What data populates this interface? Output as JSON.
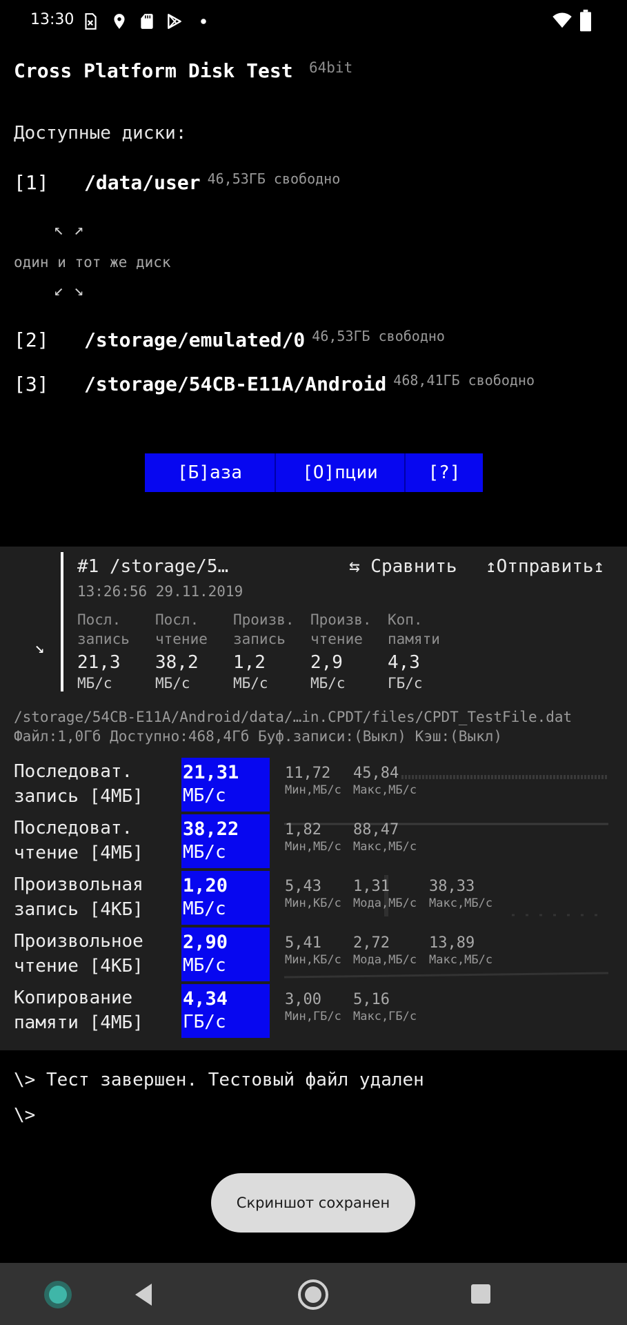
{
  "status_bar": {
    "time": "13:30",
    "icons_left": [
      "sim-card-off-icon",
      "location-icon",
      "sd-card-icon",
      "play-store-icon",
      "dot-icon"
    ],
    "icons_right": [
      "wifi-icon",
      "battery-icon"
    ]
  },
  "app": {
    "title": "Cross Platform Disk Test",
    "arch": "64bit"
  },
  "drives": {
    "heading": "Доступные диски:",
    "items": [
      {
        "num": "[1]",
        "path": "/data/user",
        "free": "46,53ГБ свободно"
      },
      {
        "num": "[2]",
        "path": "/storage/emulated/0",
        "free": "46,53ГБ свободно"
      },
      {
        "num": "[3]",
        "path": "/storage/54CB-E11A/Android",
        "free": "468,41ГБ свободно"
      }
    ],
    "same_disk_note": "один и тот же диск",
    "arrows_top": "↖ ↗",
    "arrows_bottom": "↙ ↘"
  },
  "buttons": {
    "base": "[Б]аза",
    "options": "[О]пции",
    "help": "[?]"
  },
  "summary": {
    "expand_arrow": "↘",
    "title": "#1 /storage/5…",
    "date": "13:26:56 29.11.2019",
    "compare": "⇆ Сравнить",
    "send": "↥Отправить↥",
    "columns": [
      {
        "label1": "Посл.",
        "label2": "запись",
        "value": "21,3",
        "unit": "МБ/с"
      },
      {
        "label1": "Посл.",
        "label2": "чтение",
        "value": "38,2",
        "unit": "МБ/с"
      },
      {
        "label1": "Произв.",
        "label2": "запись",
        "value": "1,2",
        "unit": "МБ/с"
      },
      {
        "label1": "Произв.",
        "label2": "чтение",
        "value": "2,9",
        "unit": "МБ/с"
      },
      {
        "label1": "Коп.",
        "label2": "памяти",
        "value": "4,3",
        "unit": "ГБ/с"
      }
    ]
  },
  "file": {
    "path": "/storage/54CB-E11A/Android/data/…in.CPDT/files/CPDT_TestFile.dat",
    "info": "Файл:1,0Гб Доступно:468,4Гб Буф.записи:(Выкл) Кэш:(Выкл)"
  },
  "tests": [
    {
      "name1": "Последоват.",
      "name2": "запись [4МБ]",
      "value": "21,31",
      "unit": "МБ/с",
      "stats": [
        {
          "v": "11,72",
          "l": "Мин,МБ/с"
        },
        {
          "v": "45,84",
          "l": "Макс,МБ/с"
        }
      ]
    },
    {
      "name1": "Последоват.",
      "name2": "чтение [4МБ]",
      "value": "38,22",
      "unit": "МБ/с",
      "stats": [
        {
          "v": "1,82",
          "l": "Мин,МБ/с"
        },
        {
          "v": "88,47",
          "l": "Макс,МБ/с"
        }
      ]
    },
    {
      "name1": "Произвольная",
      "name2": "запись [4КБ]",
      "value": "1,20",
      "unit": "МБ/с",
      "stats": [
        {
          "v": "5,43",
          "l": "Мин,КБ/с"
        },
        {
          "v": "1,31",
          "l": "Мода,МБ/с"
        },
        {
          "v": "38,33",
          "l": "Макс,МБ/с"
        }
      ]
    },
    {
      "name1": "Произвольное",
      "name2": "чтение [4КБ]",
      "value": "2,90",
      "unit": "МБ/с",
      "stats": [
        {
          "v": "5,41",
          "l": "Мин,КБ/с"
        },
        {
          "v": "2,72",
          "l": "Мода,МБ/с"
        },
        {
          "v": "13,89",
          "l": "Макс,МБ/с"
        }
      ]
    },
    {
      "name1": "Копирование",
      "name2": "памяти [4МБ]",
      "value": "4,34",
      "unit": "ГБ/с",
      "stats": [
        {
          "v": "3,00",
          "l": "Мин,ГБ/с"
        },
        {
          "v": "5,16",
          "l": "Макс,ГБ/с"
        }
      ]
    }
  ],
  "console": {
    "line1": "\\> Тест завершен. Тестовый файл удален",
    "line2": "\\>"
  },
  "toast": {
    "text": "Скриншот сохранен"
  },
  "nav_bar": {
    "icons": [
      "app-icon",
      "back-icon",
      "home-icon",
      "recents-icon"
    ]
  }
}
